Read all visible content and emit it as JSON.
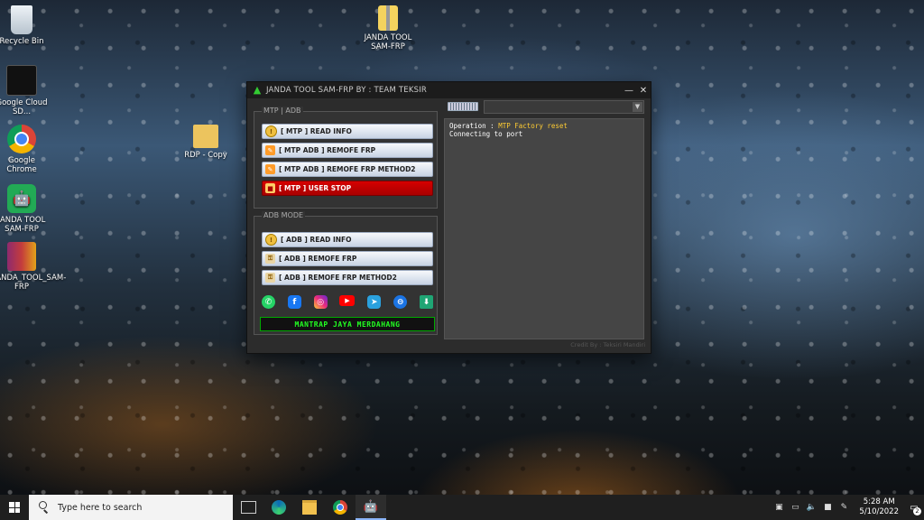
{
  "desktop": {
    "icons": [
      {
        "label": "Recycle Bin"
      },
      {
        "label": "Google Cloud SD..."
      },
      {
        "label": "Google Chrome"
      },
      {
        "label": "JANDA TOOL SAM-FRP"
      },
      {
        "label": "JANDA_TOOL_SAM-FRP"
      },
      {
        "label": "JANDA TOOL SAM-FRP"
      },
      {
        "label": "RDP - Copy"
      }
    ]
  },
  "app": {
    "title": "JANDA TOOL SAM-FRP BY : TEAM TEKSIR",
    "minimize_glyph": "—",
    "close_glyph": "✕",
    "mtp_group": {
      "title": "MTP | ADB",
      "buttons": [
        {
          "label": "[ MTP ] READ INFO"
        },
        {
          "label": "[ MTP ADB ] REMOFE FRP"
        },
        {
          "label": "[ MTP ADB ] REMOFE FRP METHOD2"
        },
        {
          "label": "[ MTP ] USER STOP"
        }
      ]
    },
    "adb_group": {
      "title": "ADB MODE",
      "buttons": [
        {
          "label": "[ ADB ] READ INFO"
        },
        {
          "label": "[ ADB ] REMOFE FRP"
        },
        {
          "label": "[ ADB ] REMOFE FRP METHOD2"
        }
      ]
    },
    "socials": [
      {
        "name": "whatsapp-icon",
        "glyph": "✆"
      },
      {
        "name": "facebook-icon",
        "glyph": "f"
      },
      {
        "name": "instagram-icon",
        "glyph": "◎"
      },
      {
        "name": "youtube-icon",
        "glyph": "▶"
      },
      {
        "name": "telegram-icon",
        "glyph": "➤"
      },
      {
        "name": "messenger-icon",
        "glyph": "⊖"
      },
      {
        "name": "download-icon",
        "glyph": "⬇"
      }
    ],
    "banner": "MANTRAP JAYA MERDAHANG",
    "port_combo_value": "",
    "log": {
      "operation_label": "Operation : ",
      "operation_value": "MTP Factory reset",
      "line2": "Connecting to port"
    },
    "credit": "Credit By : Teksiri Mandiri"
  },
  "taskbar": {
    "search_placeholder": "Type here to search",
    "time": "5:28 AM",
    "date": "5/10/2022",
    "notification_count": "2"
  }
}
